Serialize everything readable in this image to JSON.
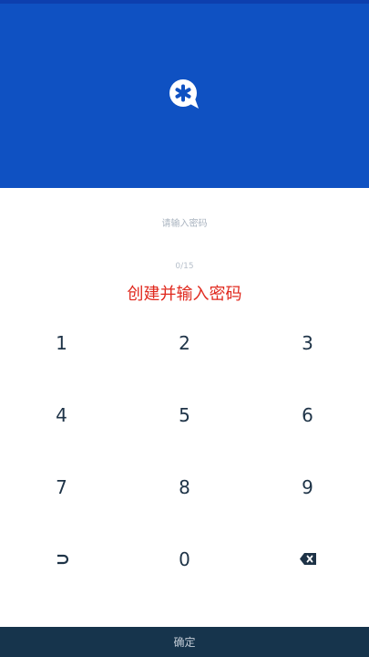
{
  "header": {
    "logo_icon": "vault-asterisk-bubble-icon",
    "background_color": "#0f51c2"
  },
  "prompt": {
    "hint": "请输入密码",
    "counter": "0/15",
    "title": "创建并输入密码",
    "title_color": "#e0291e"
  },
  "keypad": {
    "rows": [
      [
        "1",
        "2",
        "3"
      ],
      [
        "4",
        "5",
        "6"
      ],
      [
        "7",
        "8",
        "9"
      ]
    ],
    "bottom": {
      "left_icon": "return-icon",
      "zero": "0",
      "right_icon": "backspace-icon"
    }
  },
  "footer": {
    "confirm_label": "确定",
    "background_color": "#16344c"
  }
}
